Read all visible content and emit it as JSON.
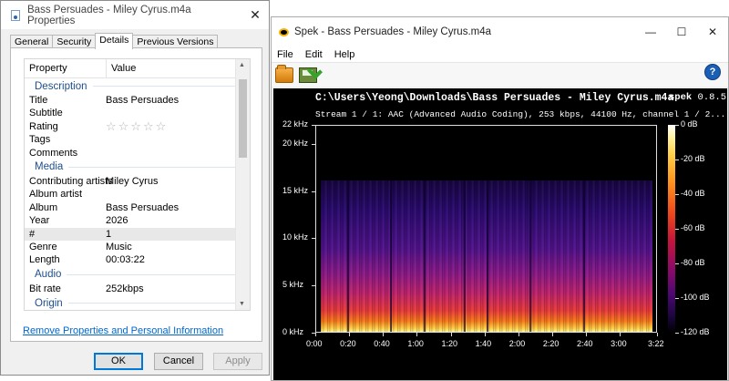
{
  "properties_window": {
    "title": "Bass Persuades - Miley Cyrus.m4a Properties",
    "close_glyph": "✕",
    "tabs": [
      {
        "label": "General",
        "active": false
      },
      {
        "label": "Security",
        "active": false
      },
      {
        "label": "Details",
        "active": true
      },
      {
        "label": "Previous Versions",
        "active": false
      }
    ],
    "grid_header": {
      "property": "Property",
      "value": "Value"
    },
    "groups": {
      "description": "Description",
      "media": "Media",
      "audio": "Audio",
      "origin": "Origin"
    },
    "description_rows": [
      {
        "key": "Title",
        "value": "Bass Persuades"
      },
      {
        "key": "Subtitle",
        "value": ""
      },
      {
        "key": "Rating",
        "value": "☆☆☆☆☆"
      },
      {
        "key": "Tags",
        "value": ""
      },
      {
        "key": "Comments",
        "value": ""
      }
    ],
    "media_rows": [
      {
        "key": "Contributing artists",
        "value": "Miley Cyrus"
      },
      {
        "key": "Album artist",
        "value": ""
      },
      {
        "key": "Album",
        "value": "Bass Persuades"
      },
      {
        "key": "Year",
        "value": "2026"
      },
      {
        "key": "#",
        "value": "1"
      },
      {
        "key": "Genre",
        "value": "Music"
      },
      {
        "key": "Length",
        "value": "00:03:22"
      }
    ],
    "audio_rows": [
      {
        "key": "Bit rate",
        "value": "252kbps"
      }
    ],
    "remove_link": "Remove Properties and Personal Information",
    "buttons": {
      "ok": "OK",
      "cancel": "Cancel",
      "apply": "Apply"
    }
  },
  "spek_window": {
    "title": "Spek - Bass Persuades - Miley Cyrus.m4a",
    "controls": {
      "minimize": "—",
      "maximize": "☐",
      "close": "✕"
    },
    "menu": [
      "File",
      "Edit",
      "Help"
    ],
    "help_glyph": "?",
    "file_path": "C:\\Users\\Yeong\\Downloads\\Bass Persuades - Miley Cyrus.m4a",
    "app_name": "spek",
    "app_version": "0.8.5",
    "stream_info": "Stream 1 / 1: AAC (Advanced Audio Coding), 253 kbps, 44100 Hz, channel 1 / 2..."
  },
  "chart_data": {
    "type": "heatmap",
    "title": "",
    "x_axis": {
      "unit": "time",
      "ticks": [
        "0:00",
        "0:20",
        "0:40",
        "1:00",
        "1:20",
        "1:40",
        "2:00",
        "2:20",
        "2:40",
        "3:00",
        "3:22"
      ],
      "range": [
        "0:00",
        "3:22"
      ]
    },
    "y_axis": {
      "unit": "kHz",
      "ticks": [
        "0 kHz",
        "5 kHz",
        "10 kHz",
        "15 kHz",
        "20 kHz",
        "22 kHz"
      ],
      "range": [
        0,
        22
      ]
    },
    "colorbar": {
      "unit": "dB",
      "ticks": [
        "0 dB",
        "-20 dB",
        "-40 dB",
        "-60 dB",
        "-80 dB",
        "-100 dB",
        "-120 dB"
      ],
      "range": [
        -120,
        0
      ]
    },
    "frequency_cutoff_khz": 16
  }
}
